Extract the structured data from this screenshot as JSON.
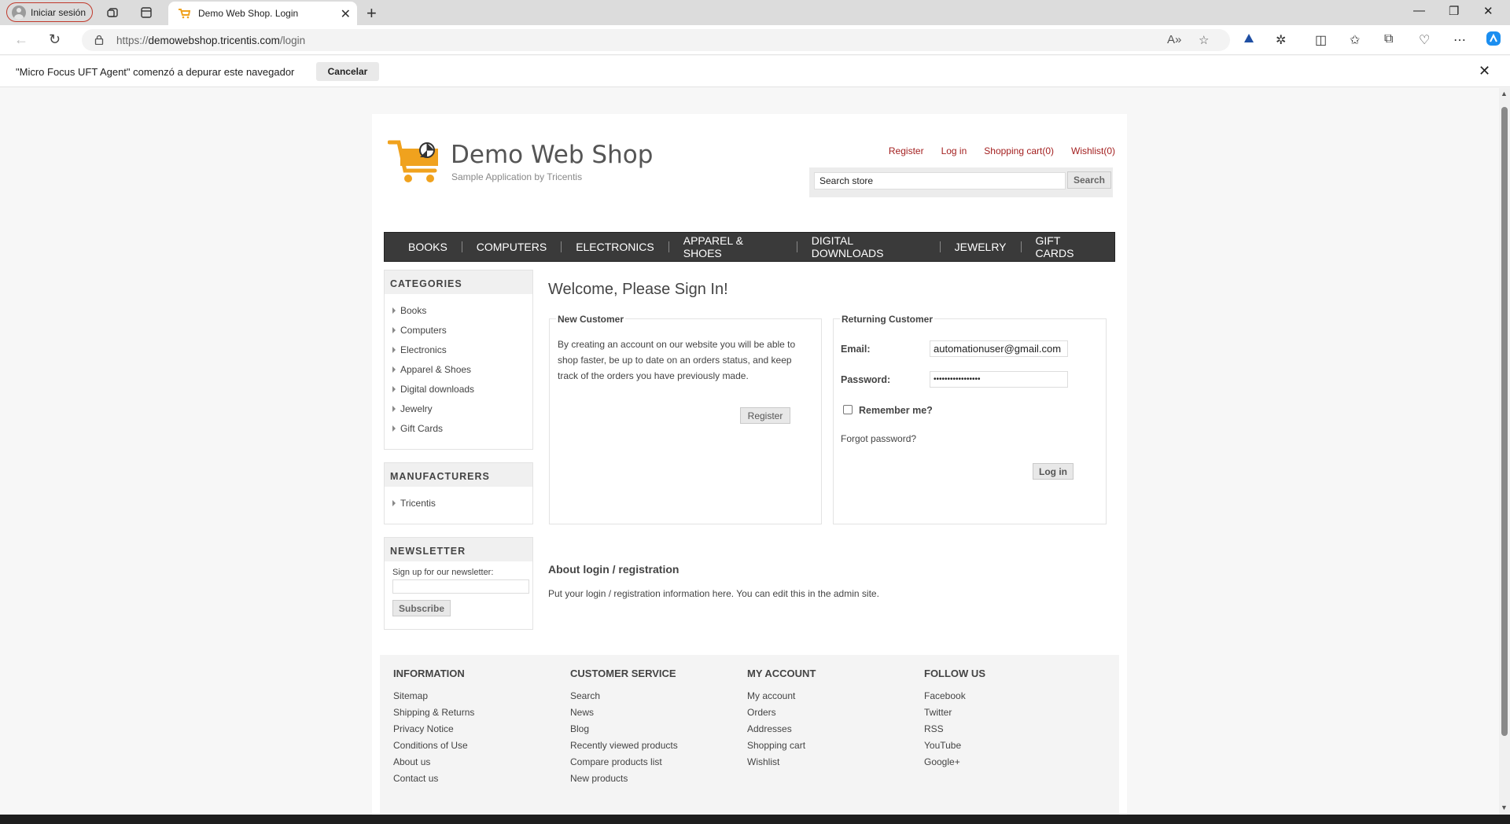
{
  "browser": {
    "profile_label": "Iniciar sesión",
    "tab_title": "Demo Web Shop. Login",
    "url_prefix": "https://",
    "url_host": "demowebshop.tricentis.com",
    "url_path": "/login",
    "infobar_message": "\"Micro Focus UFT Agent\" comenzó a depurar este navegador",
    "infobar_cancel": "Cancelar"
  },
  "header": {
    "brand": "Demo Web Shop",
    "tagline": "Sample Application by Tricentis",
    "links": [
      "Register",
      "Log in",
      "Shopping cart(0)",
      "Wishlist(0)"
    ],
    "search_value": "Search store",
    "search_button": "Search"
  },
  "menu": [
    "BOOKS",
    "COMPUTERS",
    "ELECTRONICS",
    "APPAREL & SHOES",
    "DIGITAL DOWNLOADS",
    "JEWELRY",
    "GIFT CARDS"
  ],
  "sidebar": {
    "categories_title": "CATEGORIES",
    "categories": [
      "Books",
      "Computers",
      "Electronics",
      "Apparel & Shoes",
      "Digital downloads",
      "Jewelry",
      "Gift Cards"
    ],
    "manufacturers_title": "MANUFACTURERS",
    "manufacturers": [
      "Tricentis"
    ],
    "newsletter_title": "NEWSLETTER",
    "newsletter_label": "Sign up for our newsletter:",
    "newsletter_button": "Subscribe"
  },
  "login": {
    "title": "Welcome, Please Sign In!",
    "new_customer_title": "New Customer",
    "new_customer_text": "By creating an account on our website you will be able to shop faster, be up to date on an orders status, and keep track of the orders you have previously made.",
    "register_button": "Register",
    "returning_title": "Returning Customer",
    "email_label": "Email:",
    "email_value": "automationuser@gmail.com",
    "password_label": "Password:",
    "password_value": "•••••••••••••••••",
    "remember_label": "Remember me?",
    "forgot_label": "Forgot password?",
    "login_button": "Log in",
    "about_title": "About login / registration",
    "about_text": "Put your login / registration information here. You can edit this in the admin site."
  },
  "footer": {
    "columns": [
      {
        "title": "INFORMATION",
        "links": [
          "Sitemap",
          "Shipping & Returns",
          "Privacy Notice",
          "Conditions of Use",
          "About us",
          "Contact us"
        ]
      },
      {
        "title": "CUSTOMER SERVICE",
        "links": [
          "Search",
          "News",
          "Blog",
          "Recently viewed products",
          "Compare products list",
          "New products"
        ]
      },
      {
        "title": "MY ACCOUNT",
        "links": [
          "My account",
          "Orders",
          "Addresses",
          "Shopping cart",
          "Wishlist"
        ]
      },
      {
        "title": "FOLLOW US",
        "links": [
          "Facebook",
          "Twitter",
          "RSS",
          "YouTube",
          "Google+"
        ]
      }
    ]
  },
  "colors": {
    "link_red": "#a31f1f",
    "menu_bg": "#3a3a3a",
    "logo_orange": "#f0a21e"
  }
}
